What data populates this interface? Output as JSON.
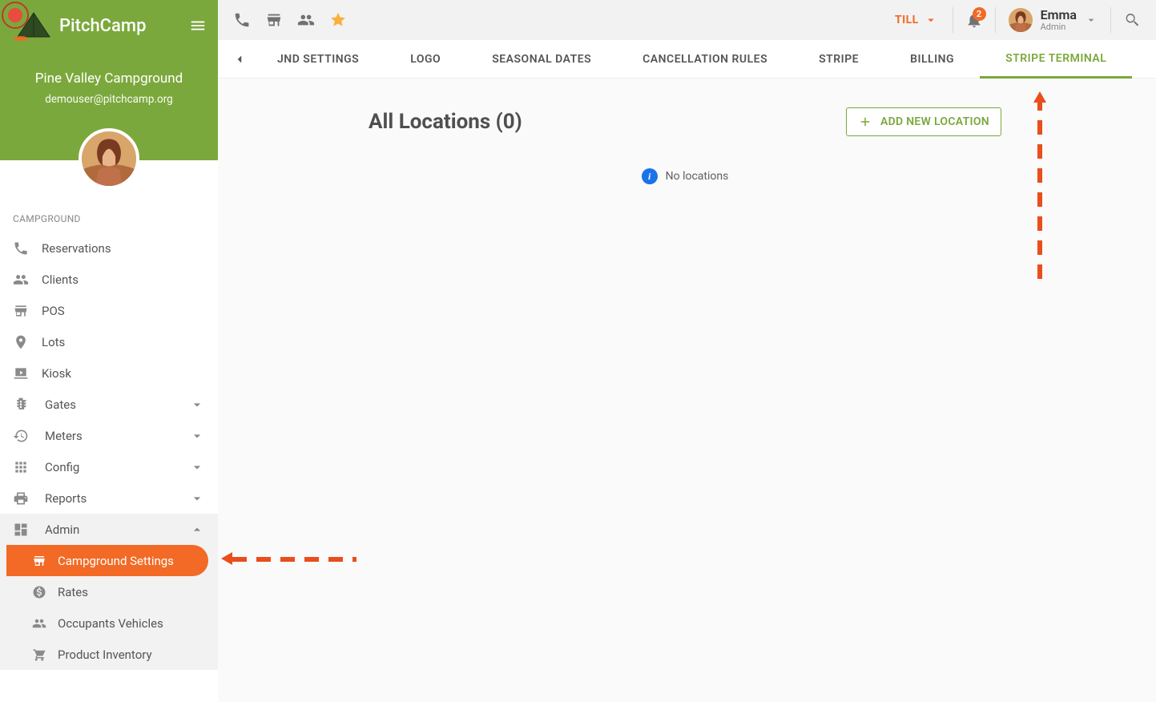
{
  "app": {
    "brand": "PitchCamp"
  },
  "campground": {
    "name": "Pine Valley Campground",
    "email": "demouser@pitchcamp.org"
  },
  "sidebar": {
    "section": "CAMPGROUND",
    "items": [
      {
        "icon": "phone",
        "label": "Reservations"
      },
      {
        "icon": "people",
        "label": "Clients"
      },
      {
        "icon": "store",
        "label": "POS"
      },
      {
        "icon": "place",
        "label": "Lots"
      },
      {
        "icon": "kiosk",
        "label": "Kiosk"
      },
      {
        "icon": "traffic",
        "label": "Gates",
        "expandable": true
      },
      {
        "icon": "history",
        "label": "Meters",
        "expandable": true
      },
      {
        "icon": "apps",
        "label": "Config",
        "expandable": true
      },
      {
        "icon": "print",
        "label": "Reports",
        "expandable": true
      },
      {
        "icon": "dashboard",
        "label": "Admin",
        "expandable": true,
        "open": true
      }
    ],
    "admin_sub": [
      {
        "icon": "store",
        "label": "Campground Settings",
        "active": true
      },
      {
        "icon": "paid",
        "label": "Rates"
      },
      {
        "icon": "people",
        "label": "Occupants Vehicles"
      },
      {
        "icon": "cart",
        "label": "Product Inventory"
      }
    ]
  },
  "topbar": {
    "till_label": "TILL",
    "notif_count": "2",
    "user": {
      "name": "Emma",
      "role": "Admin"
    }
  },
  "tabs": [
    {
      "label": "JND SETTINGS"
    },
    {
      "label": "LOGO"
    },
    {
      "label": "SEASONAL DATES"
    },
    {
      "label": "CANCELLATION RULES"
    },
    {
      "label": "STRIPE"
    },
    {
      "label": "BILLING"
    },
    {
      "label": "STRIPE TERMINAL",
      "active": true
    }
  ],
  "main": {
    "title": "All Locations (0)",
    "add_button": "ADD NEW LOCATION",
    "empty": "No locations"
  }
}
